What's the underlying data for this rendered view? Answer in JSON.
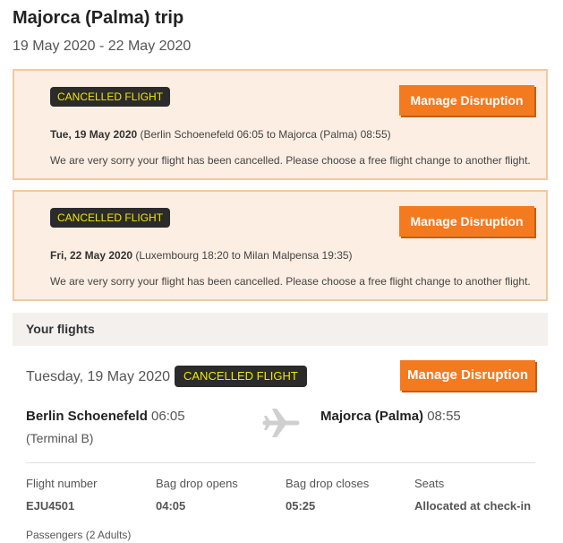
{
  "trip": {
    "title": "Majorca (Palma) trip",
    "dates": "19 May 2020 - 22 May 2020"
  },
  "alerts": [
    {
      "badge": "CANCELLED FLIGHT",
      "button": "Manage Disruption",
      "date": "Tue, 19 May 2020",
      "route": " (Berlin Schoenefeld 06:05 to Majorca (Palma) 08:55)",
      "message": "We are very sorry your flight has been cancelled. Please choose a free flight change to another flight."
    },
    {
      "badge": "CANCELLED FLIGHT",
      "button": "Manage Disruption",
      "date": "Fri, 22 May 2020",
      "route": " (Luxembourg 18:20 to Milan Malpensa 19:35)",
      "message": "We are very sorry your flight has been cancelled. Please choose a free flight change to another flight."
    }
  ],
  "flights_section": {
    "header": "Your flights",
    "flight": {
      "date": "Tuesday, 19 May 2020",
      "badge": "CANCELLED FLIGHT",
      "button": "Manage Disruption",
      "departure_airport": "Berlin Schoenefeld",
      "departure_time": " 06:05",
      "departure_terminal": "(Terminal B)",
      "arrival_airport": "Majorca (Palma)",
      "arrival_time": " 08:55",
      "plane_icon": "airplane-icon",
      "info": {
        "flight_number_label": "Flight number",
        "flight_number": "EJU4501",
        "bag_drop_opens_label": "Bag drop opens",
        "bag_drop_opens": "04:05",
        "bag_drop_closes_label": "Bag drop closes",
        "bag_drop_closes": "05:25",
        "seats_label": "Seats",
        "seats": "Allocated at check-in"
      },
      "passengers": "Passengers (2 Adults)"
    }
  },
  "colors": {
    "accent": "#f47a20",
    "alert_bg": "#fdeee3",
    "alert_border": "#f0c9a1",
    "badge_bg": "#2b2b2b",
    "badge_text": "#f2e600"
  }
}
